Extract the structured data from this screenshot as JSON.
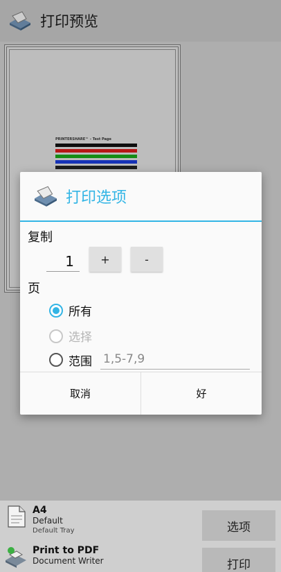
{
  "appbar": {
    "title": "打印预览",
    "icon": "printershare-logo-icon"
  },
  "preview": {
    "test_page_title": "PRINTERSHARE™ - Test Page",
    "bar_colors": [
      "#111111",
      "#d01a1a",
      "#18a018",
      "#1a3ad0",
      "#222222"
    ]
  },
  "dialog": {
    "title": "打印选项",
    "icon": "printershare-logo-icon",
    "copies_label": "复制",
    "copies_value": "1",
    "plus_label": "+",
    "minus_label": "-",
    "pages_label": "页",
    "options": [
      {
        "label": "所有",
        "checked": true,
        "enabled": true
      },
      {
        "label": "选择",
        "checked": false,
        "enabled": false
      },
      {
        "label": "范围",
        "checked": false,
        "enabled": true
      }
    ],
    "range_placeholder": "1,5-7,9",
    "cancel_label": "取消",
    "ok_label": "好"
  },
  "bottom": {
    "paper": {
      "size": "A4",
      "setting": "Default",
      "tray": "Default Tray",
      "icon": "paper-icon"
    },
    "printer": {
      "name": "Print to PDF",
      "type": "Document Writer",
      "icon": "printer-icon"
    },
    "options_button": "选项",
    "print_button": "打印"
  },
  "colors": {
    "accent": "#33b5e5"
  }
}
